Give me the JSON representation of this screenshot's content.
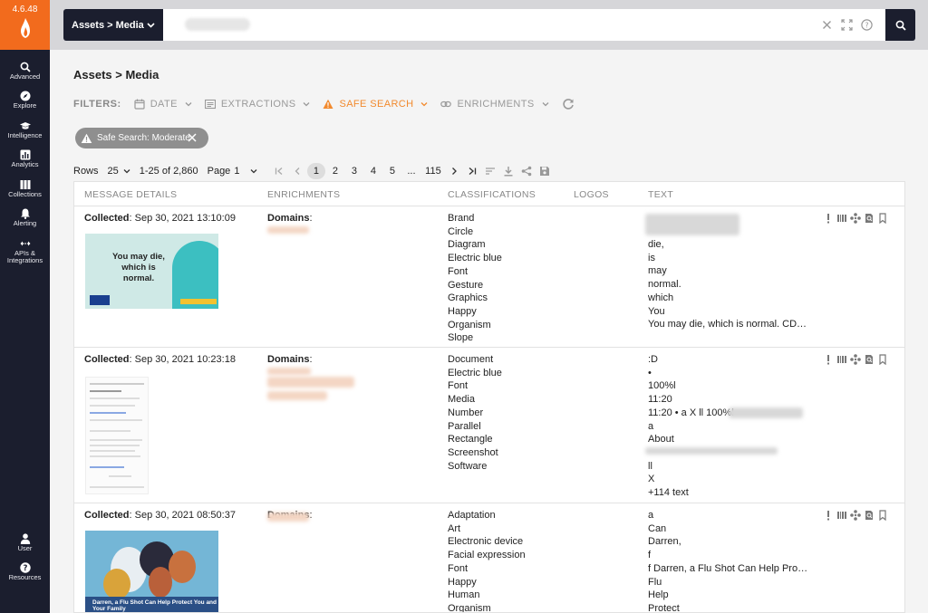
{
  "app": {
    "version": "4.6.48"
  },
  "sidebar": {
    "top": [
      {
        "id": "advanced",
        "label": "Advanced",
        "icon": "search-icon"
      },
      {
        "id": "explore",
        "label": "Explore",
        "icon": "compass-icon"
      },
      {
        "id": "intelligence",
        "label": "Intelligence",
        "icon": "graduation-cap-icon"
      },
      {
        "id": "analytics",
        "label": "Analytics",
        "icon": "bar-chart-icon"
      },
      {
        "id": "collections",
        "label": "Collections",
        "icon": "columns-icon"
      },
      {
        "id": "alerting",
        "label": "Alerting",
        "icon": "bell-icon"
      },
      {
        "id": "apis",
        "label": "APIs & Integrations",
        "icon": "arrows-icon"
      }
    ],
    "bottom": [
      {
        "id": "user",
        "label": "User",
        "icon": "user-icon"
      },
      {
        "id": "resources",
        "label": "Resources",
        "icon": "help-icon"
      }
    ]
  },
  "topbar": {
    "breadcrumb": "Assets > Media"
  },
  "page": {
    "title": "Assets > Media"
  },
  "filters": {
    "label": "FILTERS:",
    "items": [
      {
        "id": "date",
        "label": "DATE",
        "icon": "calendar-icon"
      },
      {
        "id": "extractions",
        "label": "EXTRACTIONS",
        "icon": "list-icon"
      },
      {
        "id": "safe-search",
        "label": "SAFE SEARCH",
        "icon": "warning-icon",
        "active": true
      },
      {
        "id": "enrichments",
        "label": "ENRICHMENTS",
        "icon": "link-icon"
      }
    ],
    "chip": "Safe Search: Moderate"
  },
  "pager": {
    "rows_label": "Rows",
    "rows_value": "25",
    "range": "1-25 of 2,860",
    "page_label": "Page",
    "page_value": "1",
    "pages": [
      "1",
      "2",
      "3",
      "4",
      "5",
      "...",
      "115"
    ]
  },
  "table": {
    "headers": [
      "MESSAGE DETAILS",
      "ENRICHMENTS",
      "CLASSIFICATIONS",
      "LOGOS",
      "TEXT"
    ],
    "collected_label": "Collected",
    "domains_label": "Domains",
    "rows": [
      {
        "collected": ": Sep 30, 2021 13:10:09",
        "thumb_text": "You may die, which is normal.",
        "classifications": [
          "Brand",
          "Circle",
          "Diagram",
          "Electric blue",
          "Font",
          "Gesture",
          "Graphics",
          "Happy",
          "Organism",
          "Slope"
        ],
        "text": [
          "",
          "die,",
          "is",
          "may",
          "normal.",
          "which",
          "You",
          "You may die, which is normal. CD…"
        ]
      },
      {
        "collected": ": Sep 30, 2021 10:23:18",
        "classifications": [
          "Document",
          "Electric blue",
          "Font",
          "Media",
          "Number",
          "Parallel",
          "Rectangle",
          "Screenshot",
          "Software"
        ],
        "text": [
          ":D",
          "•",
          "100%l",
          "11:20",
          "11:20 • a X ll 100%l",
          "a",
          "About",
          "",
          "ll",
          "X",
          "+114 text"
        ]
      },
      {
        "collected": ": Sep 30, 2021 08:50:37",
        "thumb_text": "Darren, a Flu Shot Can Help Protect You and Your Family",
        "classifications": [
          "Adaptation",
          "Art",
          "Electronic device",
          "Facial expression",
          "Font",
          "Happy",
          "Human",
          "Organism"
        ],
        "text": [
          "a",
          "Can",
          "Darren,",
          "f",
          "f Darren, a Flu Shot Can Help Prot…",
          "Flu",
          "Help",
          "Protect"
        ]
      }
    ]
  },
  "colors": {
    "sidebar": "#1b1e2e",
    "brand": "#f26b1d",
    "accent": "#f28a2e"
  }
}
